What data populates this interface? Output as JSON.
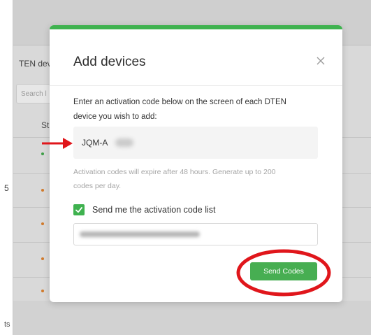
{
  "background": {
    "heading_fragment": "TEN dev",
    "search_placeholder_fragment": "Search l",
    "column_header_fragment": "St",
    "left_number": "5",
    "footer_fragment": "ts"
  },
  "modal": {
    "title": "Add devices",
    "instruction": "Enter an activation code below on the screen of each DTEN device you wish to add:",
    "code_value": "JQM-A",
    "note": "Activation codes will expire after 48 hours. Generate up to 200 codes per day.",
    "checkbox_label": "Send me the activation code list",
    "checkbox_checked": true,
    "send_button_label": "Send Codes"
  },
  "colors": {
    "accent_green": "#3fb24f",
    "annotation_red": "#e0161b"
  },
  "icons": {
    "close": "close-icon",
    "check": "check-icon",
    "arrow": "arrow-right-icon"
  }
}
